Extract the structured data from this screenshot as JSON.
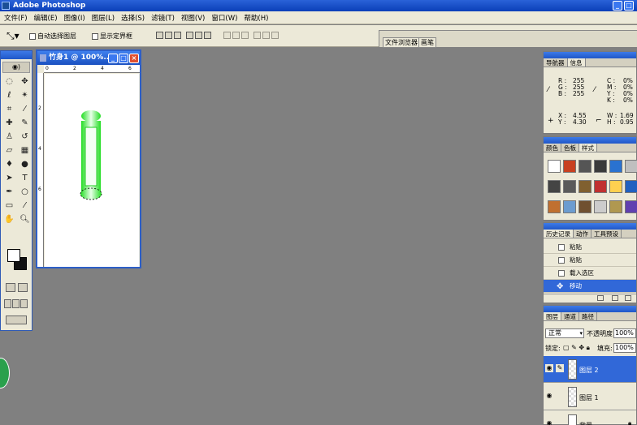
{
  "app": {
    "title": "Adobe Photoshop"
  },
  "menu": [
    "文件(F)",
    "编辑(E)",
    "图像(I)",
    "图层(L)",
    "选择(S)",
    "滤镜(T)",
    "视图(V)",
    "窗口(W)",
    "帮助(H)"
  ],
  "options": {
    "auto_select_layer": "自动选择图层",
    "show_bounding_box": "显示定界框"
  },
  "palette_well": {
    "tab1": "文件浏览器",
    "tab2": "画笔"
  },
  "document": {
    "title": "竹身1 @ 100%...",
    "ruler_h": [
      "0",
      "2",
      "4",
      "6"
    ],
    "ruler_v": [
      "2",
      "4",
      "6"
    ]
  },
  "navigator": {
    "tabs": [
      "导航器",
      "信息"
    ],
    "rgb_labels": [
      "R :",
      "G :",
      "B :"
    ],
    "rgb_values": [
      "255",
      "255",
      "255"
    ],
    "cmyk_labels": [
      "C :",
      "M :",
      "Y :",
      "K :"
    ],
    "cmyk_values": [
      "0%",
      "0%",
      "0%",
      "0%"
    ],
    "xy_labels": [
      "X :",
      "Y :"
    ],
    "xy_values": [
      "4.55",
      "4.30"
    ],
    "wh_labels": [
      "W :",
      "H :"
    ],
    "wh_values": [
      "1.69",
      "0.95"
    ]
  },
  "swatches": {
    "tabs": [
      "颜色",
      "色板",
      "样式"
    ],
    "styles": [
      "#ffffff",
      "#c84020",
      "#555555",
      "#3a3a3a",
      "#2a72d0",
      "#bfbfbf",
      "#444444",
      "#5a5a5a",
      "#806030",
      "#c03030",
      "#ffd050",
      "#2060c0",
      "#c07030",
      "#6c9cd0",
      "#705030",
      "#cccccc",
      "#b09850",
      "#6040b0"
    ]
  },
  "history": {
    "tabs": [
      "历史记录",
      "动作",
      "工具预设"
    ],
    "items": [
      "粘贴",
      "粘贴",
      "载入选区",
      "移动"
    ]
  },
  "layers": {
    "tabs": [
      "图层",
      "通道",
      "路径"
    ],
    "blend_mode": "正常",
    "opacity_label": "不透明度:",
    "opacity_value": "100%",
    "lock_label": "锁定:",
    "fill_label": "填充:",
    "fill_value": "100%",
    "items": [
      "图层 2",
      "图层 1",
      "背景"
    ]
  },
  "colors": {
    "title_blue": "#0b3fb8",
    "selection_blue": "#3168d8",
    "bamboo_green": "#22dd22",
    "workspace_gray": "#808080"
  }
}
